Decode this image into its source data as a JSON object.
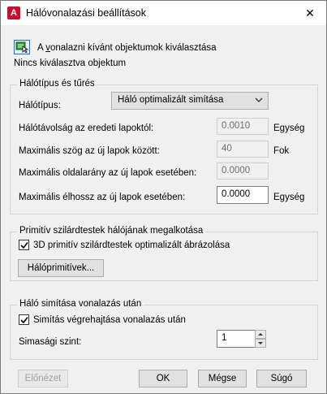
{
  "window": {
    "title": "Hálóvonalazási beállítások",
    "icon": "autocad-icon",
    "close_glyph": "✕"
  },
  "selection": {
    "label_prefix": "A ",
    "label_mnemonic": "v",
    "label_rest": "onalazni kívánt objektumok kiválasztása",
    "status": "Nincs kiválasztva objektum"
  },
  "mesh_type_group": {
    "title": "Hálótípus és tűrés",
    "type_label": "Hálótípus:",
    "type_value": "Háló optimalizált simítása",
    "distance_label": "Hálótávolság az eredeti lapoktól:",
    "distance_value": "0.0010",
    "distance_unit": "Egység",
    "angle_label": "Maximális szög az új lapok között:",
    "angle_value": "40",
    "angle_unit": "Fok",
    "aspect_label": "Maximális oldalarány az új lapok esetében:",
    "aspect_value": "0.0000",
    "edge_label": "Maximális élhossz az új lapok esetében:",
    "edge_value": "0.0000",
    "edge_unit": "Egység"
  },
  "primitive_group": {
    "title": "Primitív szilárdtestek hálójának megalkotása",
    "checkbox_label": "3D primitív szilárdtestek optimalizált ábrázolása",
    "checkbox_checked": true,
    "button_label": "Hálóprimitívek..."
  },
  "smooth_group": {
    "title": "Háló simítása vonalazás után",
    "checkbox_label": "Simítás végrehajtása vonalazás után",
    "checkbox_checked": true,
    "level_label": "Simasági szint:",
    "level_value": "1"
  },
  "footer": {
    "preview_label": "Előnézet",
    "ok_label": "OK",
    "cancel_label": "Mégse",
    "help_label": "Súgó"
  }
}
